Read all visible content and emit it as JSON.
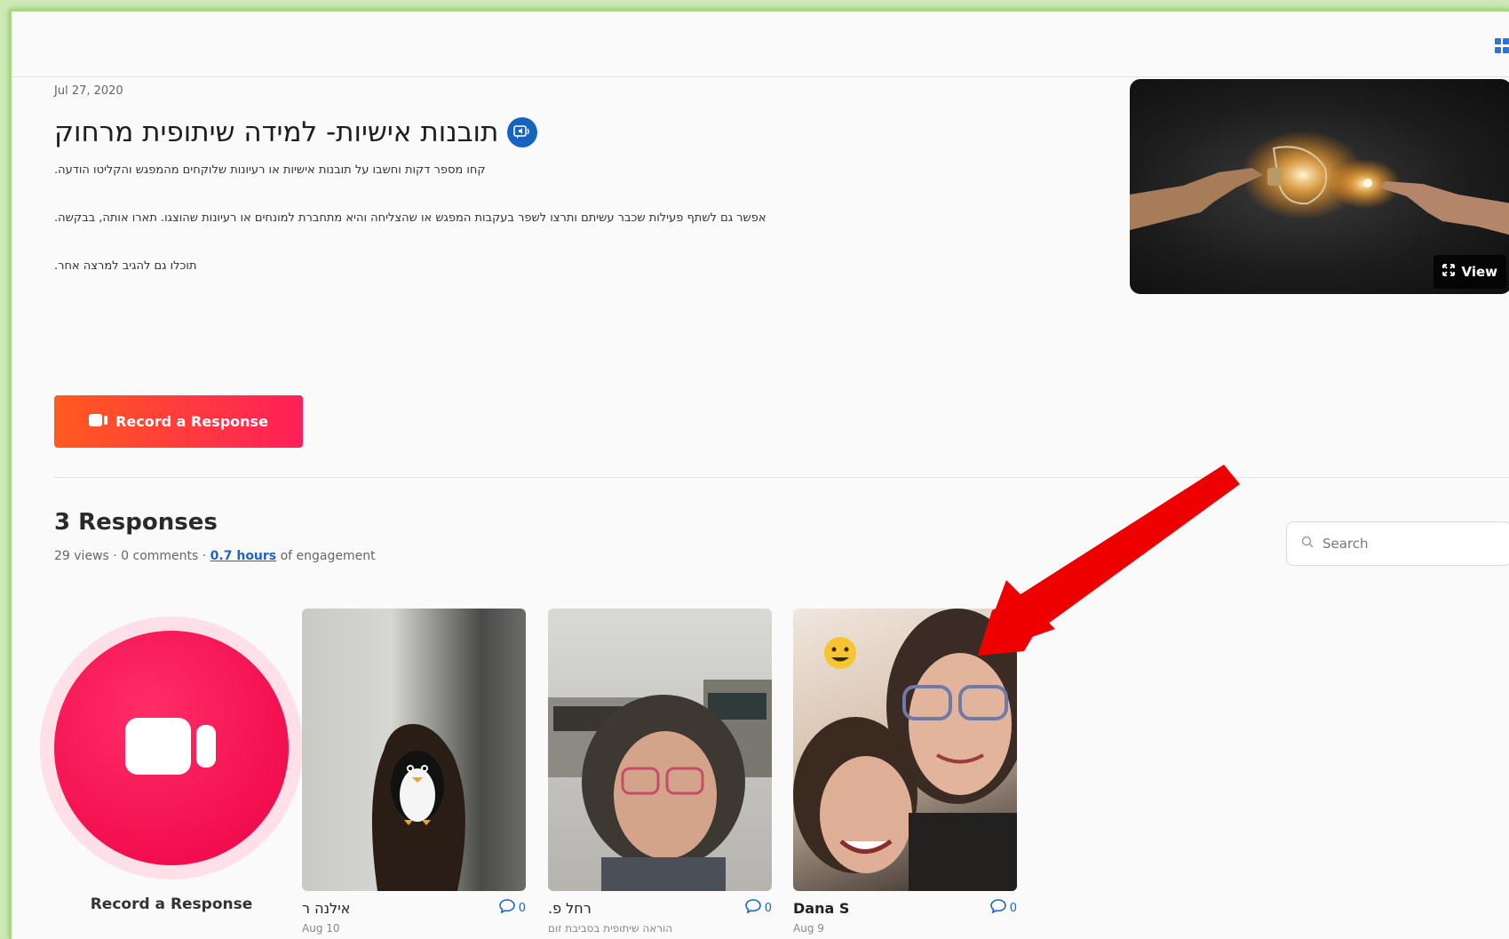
{
  "post": {
    "date": "Jul 27, 2020",
    "title": "תובנות אישיות- למידה שיתופית מרחוק",
    "paragraphs": [
      ".קחו מספר דקות וחשבו על תובנות אישיות או רעיונות שלוקחים מהמפגש והקליטו הודעה",
      ".אפשר גם לשתף פעילות שכבר עשיתם ותרצו לשפר בעקבות המפגש או שהצליחה והיא מתחברת למונחים או רעיונות שהוצגו. תארו אותה, בבקשה",
      ".תוכלו גם להגיב למרצה אחר"
    ],
    "view_label": "View",
    "record_label": "Record a Response"
  },
  "responses": {
    "heading": "3 Responses",
    "stats_prefix": "29 views · 0 comments · ",
    "stats_link": "0.7 hours",
    "stats_suffix": " of engagement",
    "search_placeholder": "Search",
    "record_label": "Record a Response",
    "cards": [
      {
        "name": "אילנה ר",
        "count": "0",
        "sub": "Aug 10"
      },
      {
        "name": ".רחל פ",
        "count": "0",
        "sub": "הוראה שיתופית בסביבת זום"
      },
      {
        "name": "Dana S",
        "count": "0",
        "sub": "Aug 9"
      }
    ]
  },
  "colors": {
    "accent_orange": "#ff5a1f",
    "accent_pink": "#f20f4f",
    "link_blue": "#1a66c9",
    "annotation_arrow": "#ee0000"
  }
}
